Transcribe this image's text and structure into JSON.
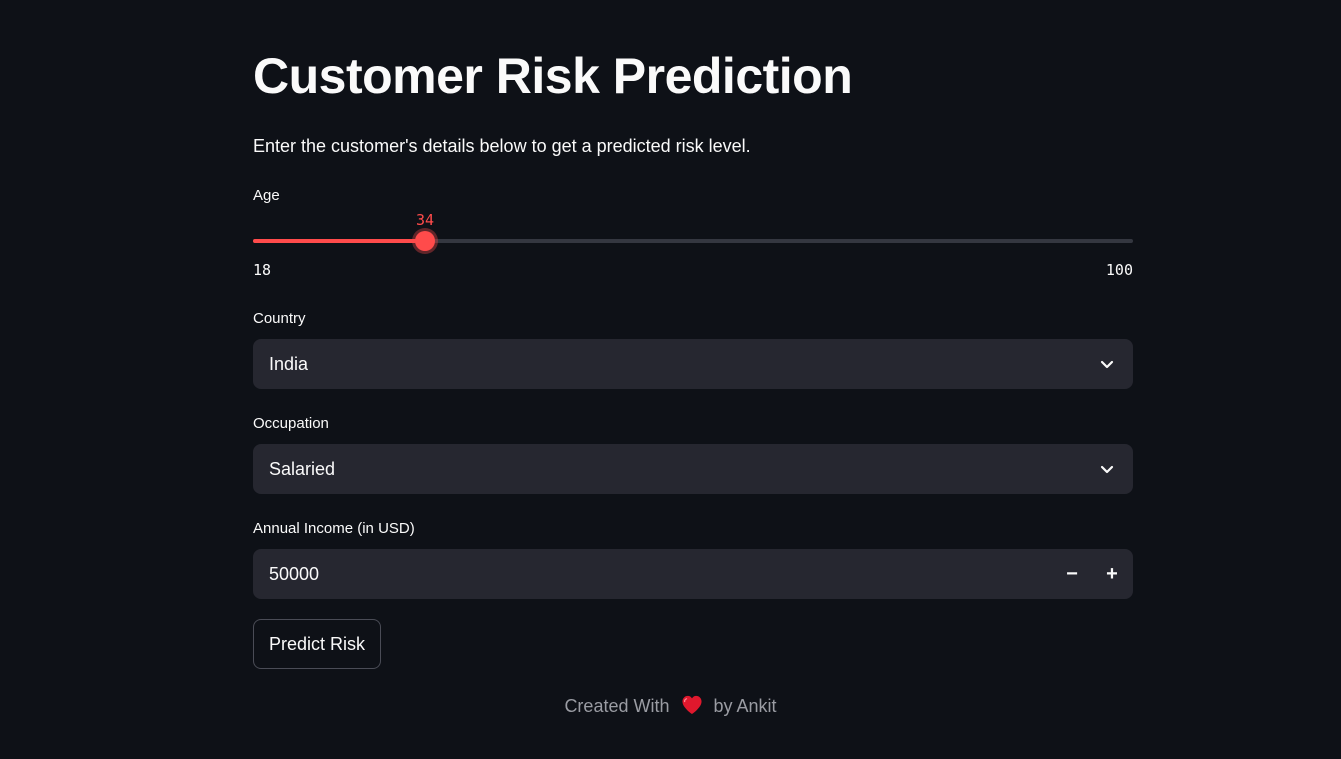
{
  "page": {
    "title": "Customer Risk Prediction",
    "subtitle": "Enter the customer's details below to get a predicted risk level."
  },
  "age": {
    "label": "Age",
    "value": 34,
    "min": 18,
    "max": 100
  },
  "country": {
    "label": "Country",
    "selected": "India"
  },
  "occupation": {
    "label": "Occupation",
    "selected": "Salaried"
  },
  "income": {
    "label": "Annual Income (in USD)",
    "value": "50000",
    "decrement_symbol": "−",
    "increment_symbol": "+"
  },
  "actions": {
    "predict_label": "Predict Risk"
  },
  "footer": {
    "prefix": "Created With",
    "suffix": "by Ankit",
    "icon": "heart-icon"
  },
  "colors": {
    "background": "#0e1117",
    "accent": "#ff4b4b",
    "input_background": "#262730",
    "text": "#fafafa"
  }
}
